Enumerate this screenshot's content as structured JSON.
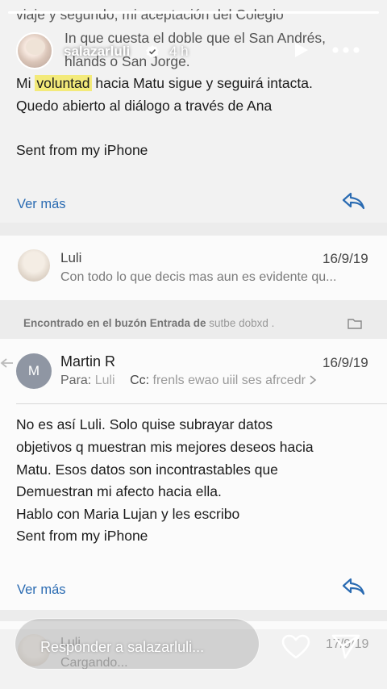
{
  "header": {
    "username": "salazarluli",
    "time": "4 h",
    "progress": 1.0
  },
  "email1": {
    "lines": [
      "viaje y segundo, mi aceptación del Colegio",
      "In que cuesta el doble que el San Andrés,",
      "hlands o San Jorge.",
      "Quedo abierto al diálogo a través de Ana",
      "Sent from my iPhone"
    ],
    "line_mi": "Mi",
    "highlight_word": "voluntad",
    "line_rest": "hacia Matu sigue y seguirá intacta.",
    "ver_mas": "Ver más"
  },
  "message_luli": {
    "from": "Luli",
    "date": "16/9/19",
    "preview": "Con todo lo que decis mas aun es evidente qu..."
  },
  "found_in": {
    "text": "Encontrado en el buzón Entrada de",
    "garbled": "sutbe dobxd ."
  },
  "email2": {
    "avatar_letter": "M",
    "from": "Martin R",
    "date": "16/9/19",
    "to_label": "Para:",
    "to_value": "Luli",
    "cc_label": "Cc:",
    "cc_value": "frenls ewao uiil ses afrcedr",
    "body": [
      "No es así Luli.  Solo quise subrayar datos",
      "objetivos q muestran mis mejores deseos hacia",
      "Matu. Esos datos son incontrastables que",
      "Demuestran mi afecto hacia ella.",
      "Hablo con Maria Lujan y les escribo",
      "Sent from my iPhone"
    ],
    "ver_mas": "Ver más"
  },
  "behind_bar": {
    "name": "Luli",
    "date": "17/9/19",
    "loading": "Cargando..."
  },
  "bottom": {
    "reply_placeholder": "Responder a salazarluli..."
  },
  "icons": [
    "verified-icon",
    "play-icon",
    "more-icon",
    "reply-icon",
    "folder-icon",
    "back-arrow-icon",
    "chevron-right-icon",
    "heart-icon",
    "send-icon"
  ],
  "colors": {
    "link": "#2a6bb2",
    "highlight": "#f3ea7a",
    "verified": "#ffffff"
  }
}
